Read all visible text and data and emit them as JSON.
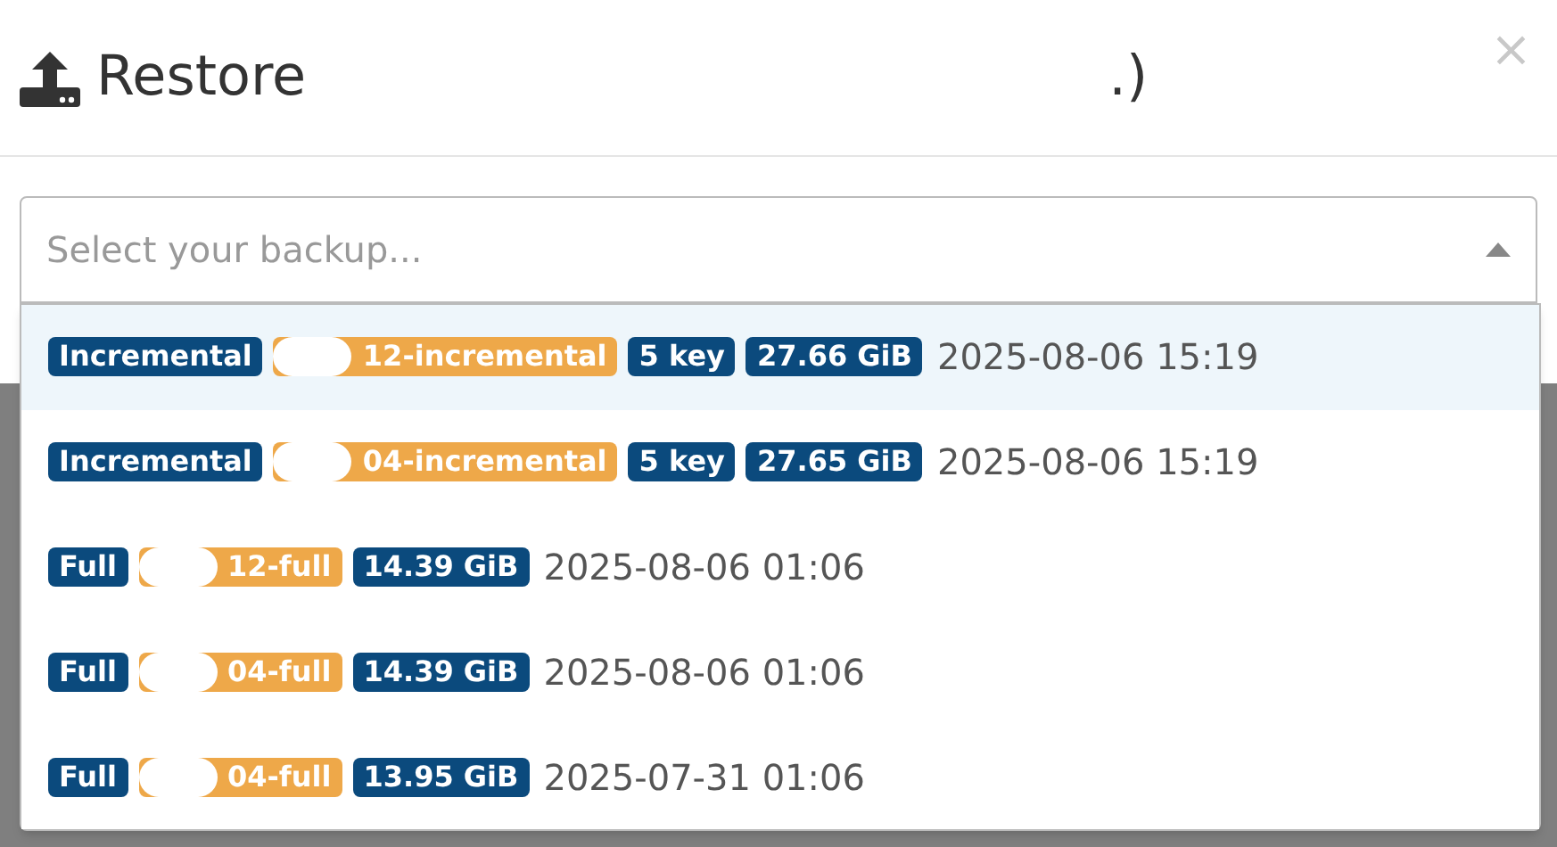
{
  "dialog": {
    "title": "Restore",
    "title_fragment": ".)",
    "close": "×"
  },
  "select": {
    "placeholder": "Select your backup...",
    "expanded": true
  },
  "options": [
    {
      "selected": true,
      "tags": [
        {
          "kind": "type",
          "text": "Incremental"
        },
        {
          "kind": "name",
          "text": "12-incremental"
        },
        {
          "kind": "keys",
          "text": "5 key"
        },
        {
          "kind": "size",
          "text": "27.66 GiB"
        }
      ],
      "date": "2025-08-06 15:19"
    },
    {
      "selected": false,
      "tags": [
        {
          "kind": "type",
          "text": "Incremental"
        },
        {
          "kind": "name",
          "text": "04-incremental"
        },
        {
          "kind": "keys",
          "text": "5 key"
        },
        {
          "kind": "size",
          "text": "27.65 GiB"
        }
      ],
      "date": "2025-08-06 15:19"
    },
    {
      "selected": false,
      "tags": [
        {
          "kind": "type",
          "text": "Full"
        },
        {
          "kind": "name",
          "text": "12-full"
        },
        {
          "kind": "size",
          "text": "14.39 GiB"
        }
      ],
      "date": "2025-08-06 01:06"
    },
    {
      "selected": false,
      "tags": [
        {
          "kind": "type",
          "text": "Full"
        },
        {
          "kind": "name",
          "text": "04-full"
        },
        {
          "kind": "size",
          "text": "14.39 GiB"
        }
      ],
      "date": "2025-08-06 01:06"
    },
    {
      "selected": false,
      "tags": [
        {
          "kind": "type",
          "text": "Full"
        },
        {
          "kind": "name",
          "text": "04-full"
        },
        {
          "kind": "size",
          "text": "13.95 GiB"
        }
      ],
      "date": "2025-07-31 01:06"
    }
  ]
}
